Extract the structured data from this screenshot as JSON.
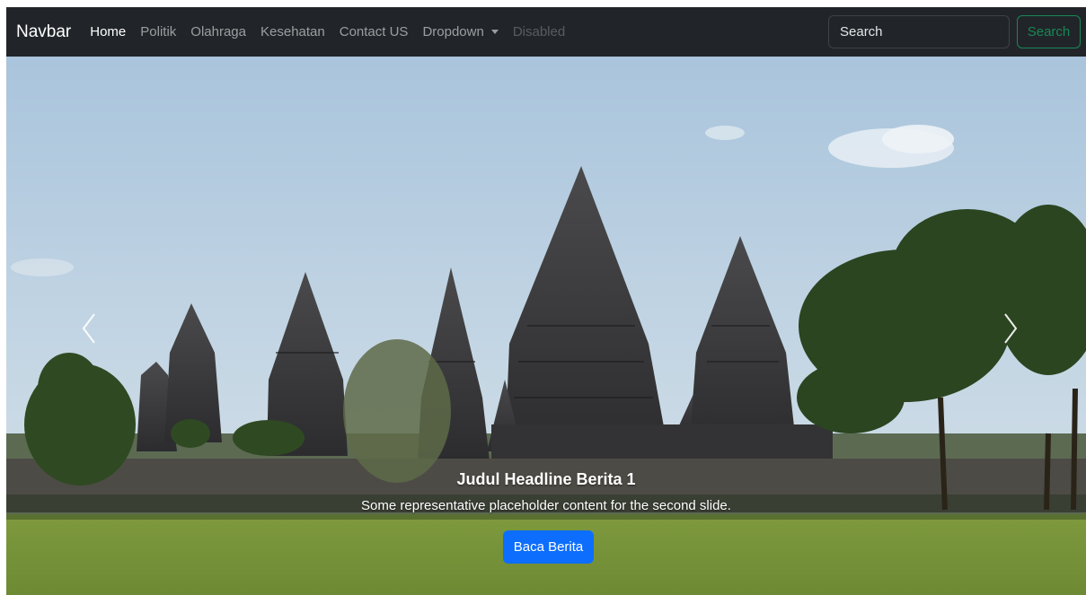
{
  "navbar": {
    "brand": "Navbar",
    "links": [
      {
        "label": "Home",
        "state": "active"
      },
      {
        "label": "Politik",
        "state": "normal"
      },
      {
        "label": "Olahraga",
        "state": "normal"
      },
      {
        "label": "Kesehatan",
        "state": "normal"
      },
      {
        "label": "Contact US",
        "state": "normal"
      }
    ],
    "dropdown_label": "Dropdown",
    "disabled_label": "Disabled",
    "search": {
      "placeholder": "Search",
      "value": "",
      "button_label": "Search"
    }
  },
  "carousel": {
    "caption_title": "Judul Headline Berita 1",
    "caption_text": "Some representative placeholder content for the second slide.",
    "button_label": "Baca Berita",
    "image_subject": "Prambanan temple complex with trees and green lawn under blue sky"
  },
  "colors": {
    "navbar_bg": "#212529",
    "search_button": "#198754",
    "primary_button": "#0d6efd",
    "nav_active": "#ffffff",
    "nav_inactive": "rgba(255,255,255,0.55)"
  },
  "icons": {
    "prev": "chevron-left-icon",
    "next": "chevron-right-icon",
    "dropdown": "caret-down-icon"
  }
}
